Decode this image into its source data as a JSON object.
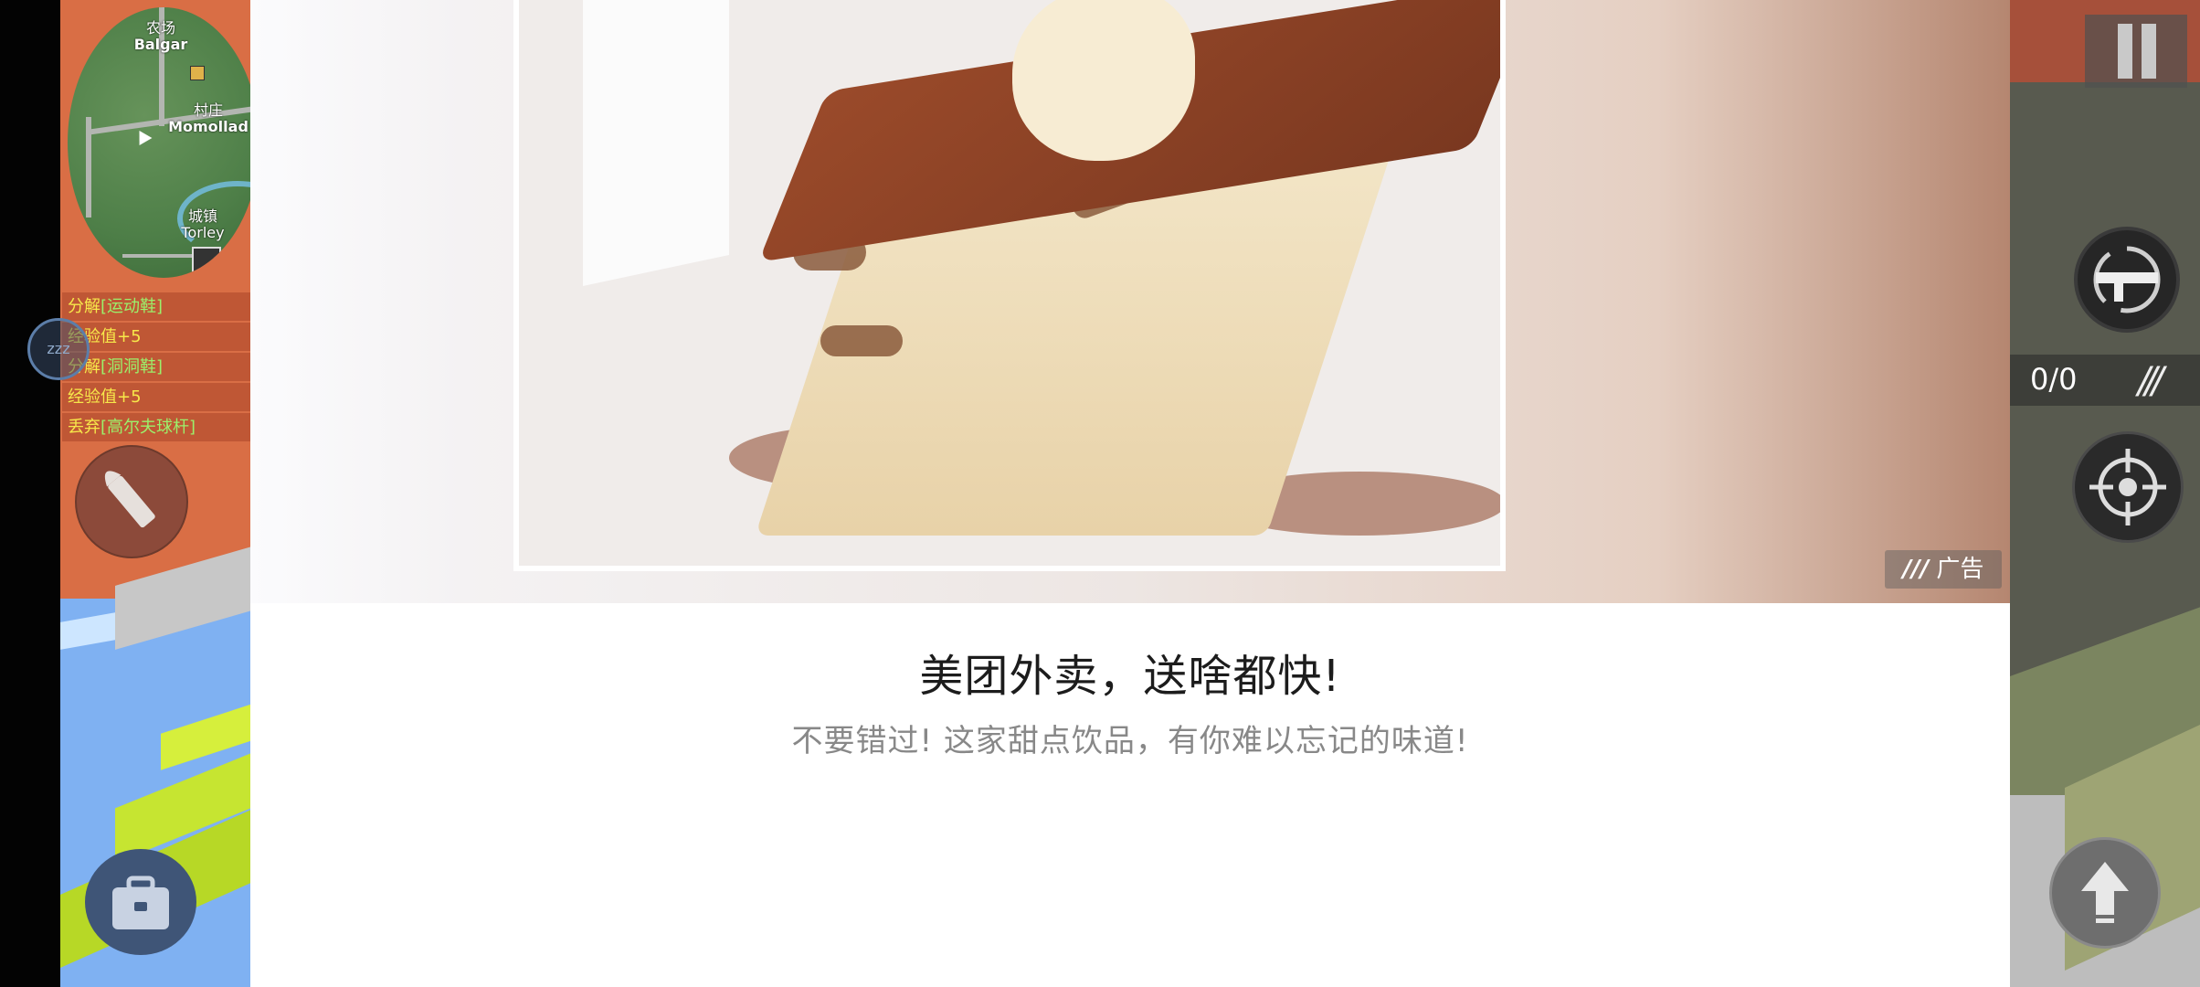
{
  "minimap": {
    "labels": [
      {
        "cn": "农场",
        "en": "Balgar"
      },
      {
        "cn": "村庄",
        "en": "Momollad"
      },
      {
        "cn": "城镇",
        "en": "Torley"
      }
    ]
  },
  "feed": [
    {
      "action": "分解",
      "item": "[运动鞋]"
    },
    {
      "action": "经验值+5",
      "item": ""
    },
    {
      "action": "分解",
      "item": "[洞洞鞋]"
    },
    {
      "action": "经验值+5",
      "item": ""
    },
    {
      "action": "丢弃",
      "item": "[高尔夫球杆]"
    }
  ],
  "sleep_icon_text": "zzz",
  "ad": {
    "badge_label": "广告",
    "title": "美团外卖，送啥都快!",
    "subtitle": "不要错过! 这家甜点饮品，有你难以忘记的味道!"
  },
  "hud": {
    "ammo_count": "0/0"
  },
  "icons": {
    "ammo": "bullet-icon",
    "bag": "backpack-icon",
    "pause": "pause-icon",
    "weapon": "rifle-swap-icon",
    "aim": "crosshair-icon",
    "jump": "up-arrow-icon",
    "ad": "ad-logo-icon"
  },
  "colors": {
    "feed_action": "#f7e84a",
    "feed_item": "#9bf06b",
    "game_orange": "#d96e45",
    "ad_bg": "#ffffff"
  }
}
